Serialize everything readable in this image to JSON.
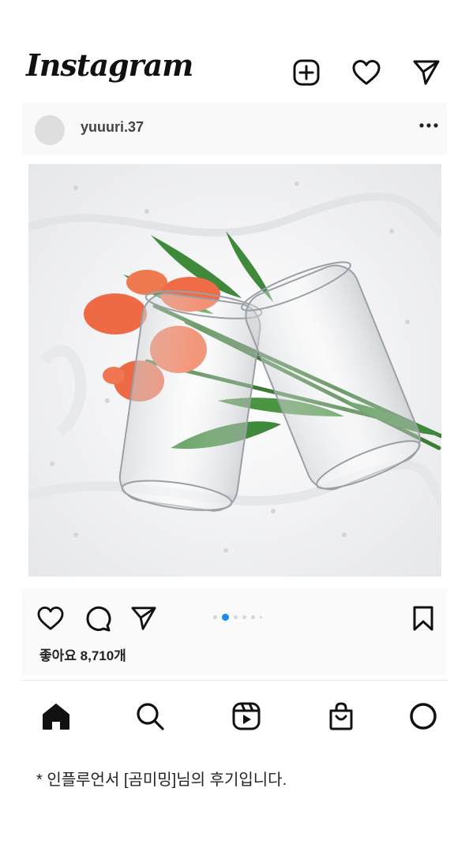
{
  "header": {
    "logo_text": "Instagram",
    "icons": [
      "new-post-icon",
      "heart-icon",
      "send-icon"
    ]
  },
  "post": {
    "username": "yuuuri.37",
    "likes_text": "좋아요 8,710개",
    "carousel": {
      "total": 6,
      "active_index": 1
    }
  },
  "bottom_nav": [
    "home-icon",
    "search-icon",
    "reels-icon",
    "shop-icon",
    "profile-icon"
  ],
  "footnote": "* 인플루언서 [곰미밍]님의 후기입니다."
}
